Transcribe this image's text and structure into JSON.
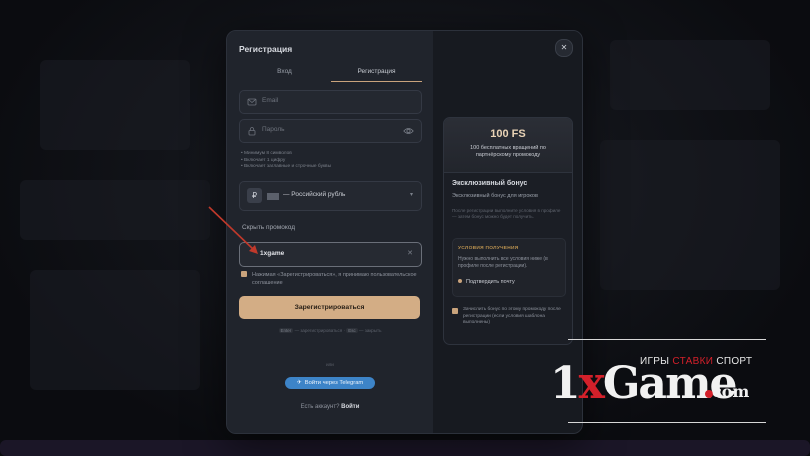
{
  "modal": {
    "title": "Регистрация",
    "tabs": [
      {
        "label": "Вход"
      },
      {
        "label": "Регистрация"
      }
    ],
    "email": {
      "placeholder": "Email"
    },
    "password": {
      "placeholder": "Пароль"
    },
    "password_hints": [
      "Минимум 8 символов",
      "Включает 1 цифру",
      "Включает заглавные и строчные буквы"
    ],
    "currency": {
      "symbol": "₽",
      "label": "— Российский рубль",
      "arrow": "▾"
    },
    "promo_toggle": "Скрыть промокод",
    "promo": {
      "value": "1xgame",
      "clear": "✕"
    },
    "agreement": "Нажимая «Зарегистрироваться», я принимаю пользовательское соглашение",
    "register_button": "Зарегистрироваться",
    "kbd_hint": {
      "enter": "Enter",
      "mid": "— зарегистрироваться ·",
      "esc": "Esc",
      "end": "— закрыть"
    },
    "or": "или",
    "telegram": {
      "icon": "✈",
      "label": "Войти через Telegram"
    },
    "have_account": "Есть аккаунт?",
    "login_link": "Войти",
    "close": "✕"
  },
  "bonus": {
    "amount": "100 FS",
    "subtitle": "100 бесплатных вращений по партнёрскому промокоду",
    "exclusive_title": "Эксклюзивный бонус",
    "exclusive_sub": "Эксклюзивный бонус для игроков",
    "exclusive_desc": "После регистрации выполните условия в профиле — затем бонус можно будет получить.",
    "conditions_title": "УСЛОВИЯ ПОЛУЧЕНИЯ",
    "conditions_desc": "Нужно выполнить все условия ниже (в профиле после регистрации).",
    "conditions_step": "Подтвердить почту",
    "auto_credit": "Зачислить бонус по этому промокоду после регистрации (если условия шаблона выполнены)"
  },
  "logo": {
    "tag_left": "ИГРЫ ",
    "tag_red": "СТАВКИ",
    "tag_right": " СПОРТ",
    "brand_1": "1",
    "brand_x": "x",
    "brand_rest": "Game",
    "dotcom": "com"
  },
  "colors": {
    "accent": "#d3ad85",
    "telegram": "#3d84c8",
    "brand_red": "#d3202a"
  }
}
